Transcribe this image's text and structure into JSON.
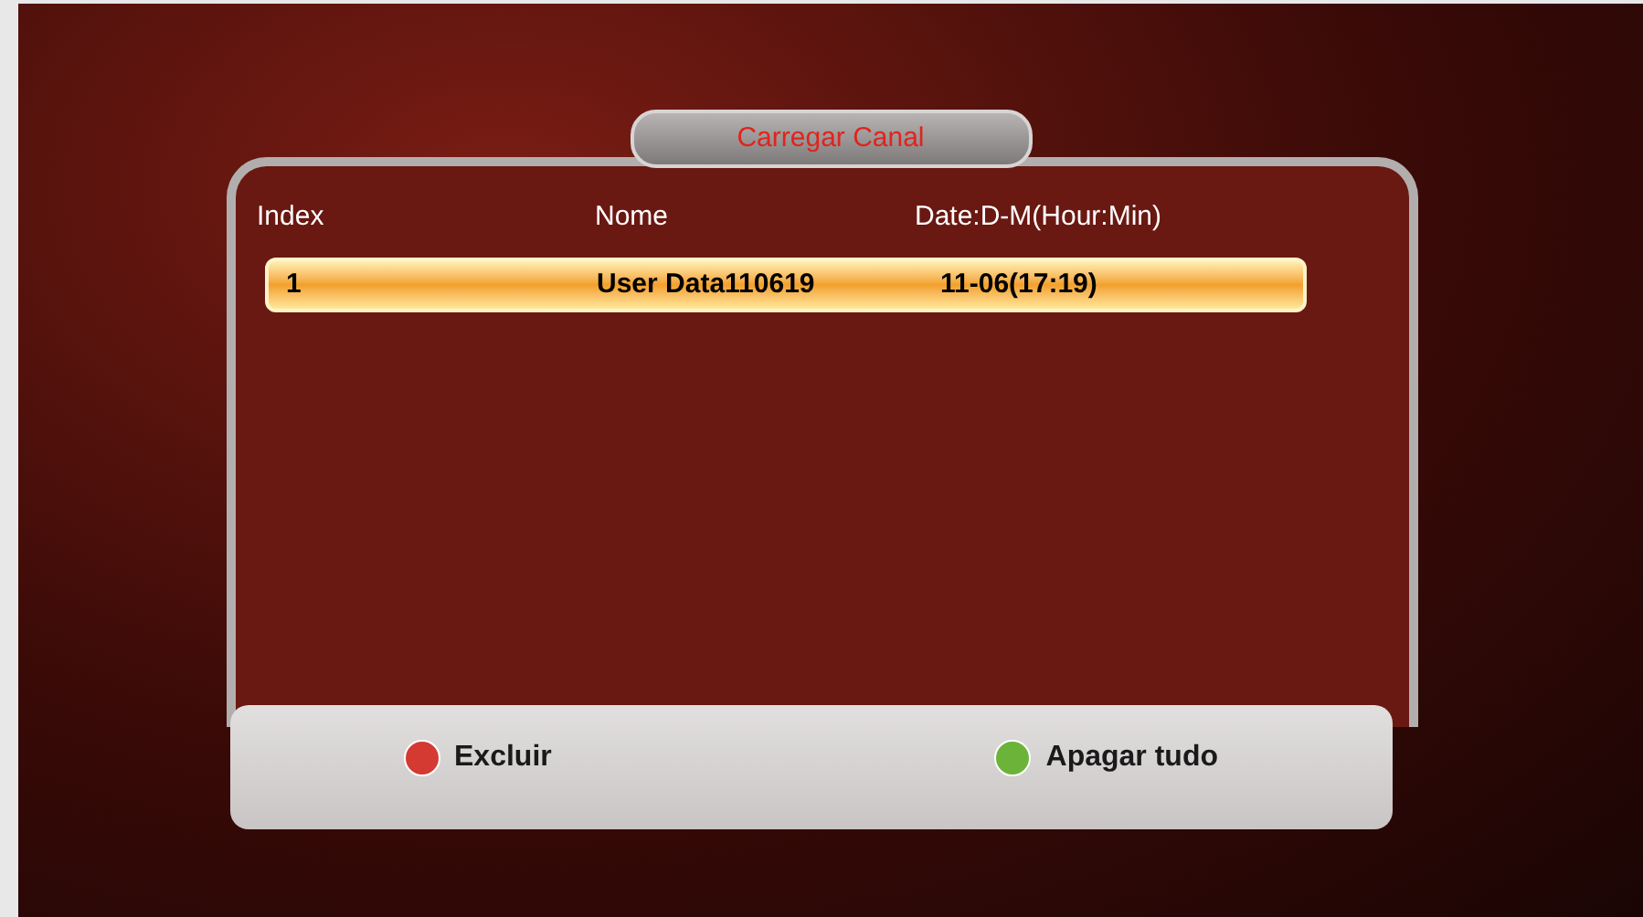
{
  "title": "Carregar Canal",
  "columns": [
    "Index",
    "Nome",
    "Date:D-M(Hour:Min)"
  ],
  "rows": [
    {
      "index": "1",
      "name": "User Data110619",
      "date": "11-06(17:19)",
      "selected": true
    }
  ],
  "buttons": [
    {
      "label": "Excluir",
      "color": "#d43a32"
    },
    {
      "label": "Apagar tudo",
      "color": "#6cb33a"
    }
  ]
}
